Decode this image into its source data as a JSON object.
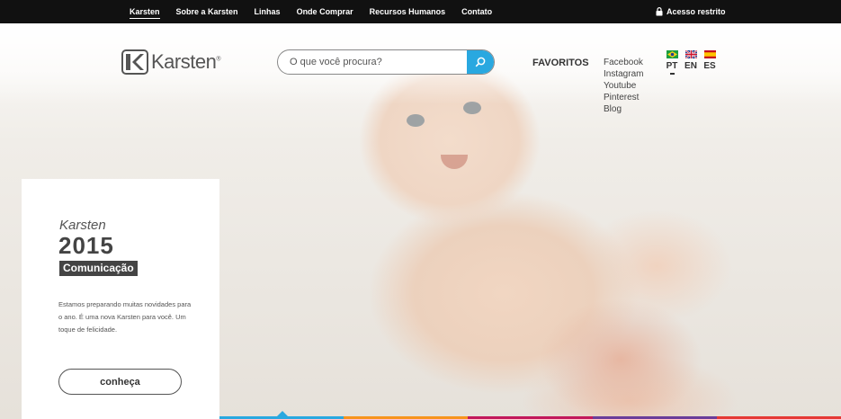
{
  "topbar": {
    "nav": [
      "Karsten",
      "Sobre a Karsten",
      "Linhas",
      "Onde Comprar",
      "Recursos Humanos",
      "Contato"
    ],
    "restricted_access": "Acesso restrito"
  },
  "header": {
    "logo_text": "Karsten",
    "search": {
      "placeholder": "O que você procura?"
    },
    "favoritos": "FAVORITOS",
    "social": [
      "Facebook",
      "Instagram",
      "Youtube",
      "Pinterest",
      "Blog"
    ],
    "languages": [
      {
        "code": "PT",
        "flag": "brazil-flag-icon"
      },
      {
        "code": "EN",
        "flag": "uk-flag-icon"
      },
      {
        "code": "ES",
        "flag": "spain-flag-icon"
      }
    ]
  },
  "promo": {
    "brand": "Karsten",
    "year": "2015",
    "tag": "Comunicação",
    "text": "Estamos preparando muitas novidades para o ano. É uma nova Karsten para você. Um toque de felicidade.",
    "button": "conheça"
  },
  "colors": {
    "accent": "#29a8e0",
    "bar": [
      "#29a8e0",
      "#f7941d",
      "#c2185b",
      "#6a3d9a",
      "#e53935"
    ]
  }
}
